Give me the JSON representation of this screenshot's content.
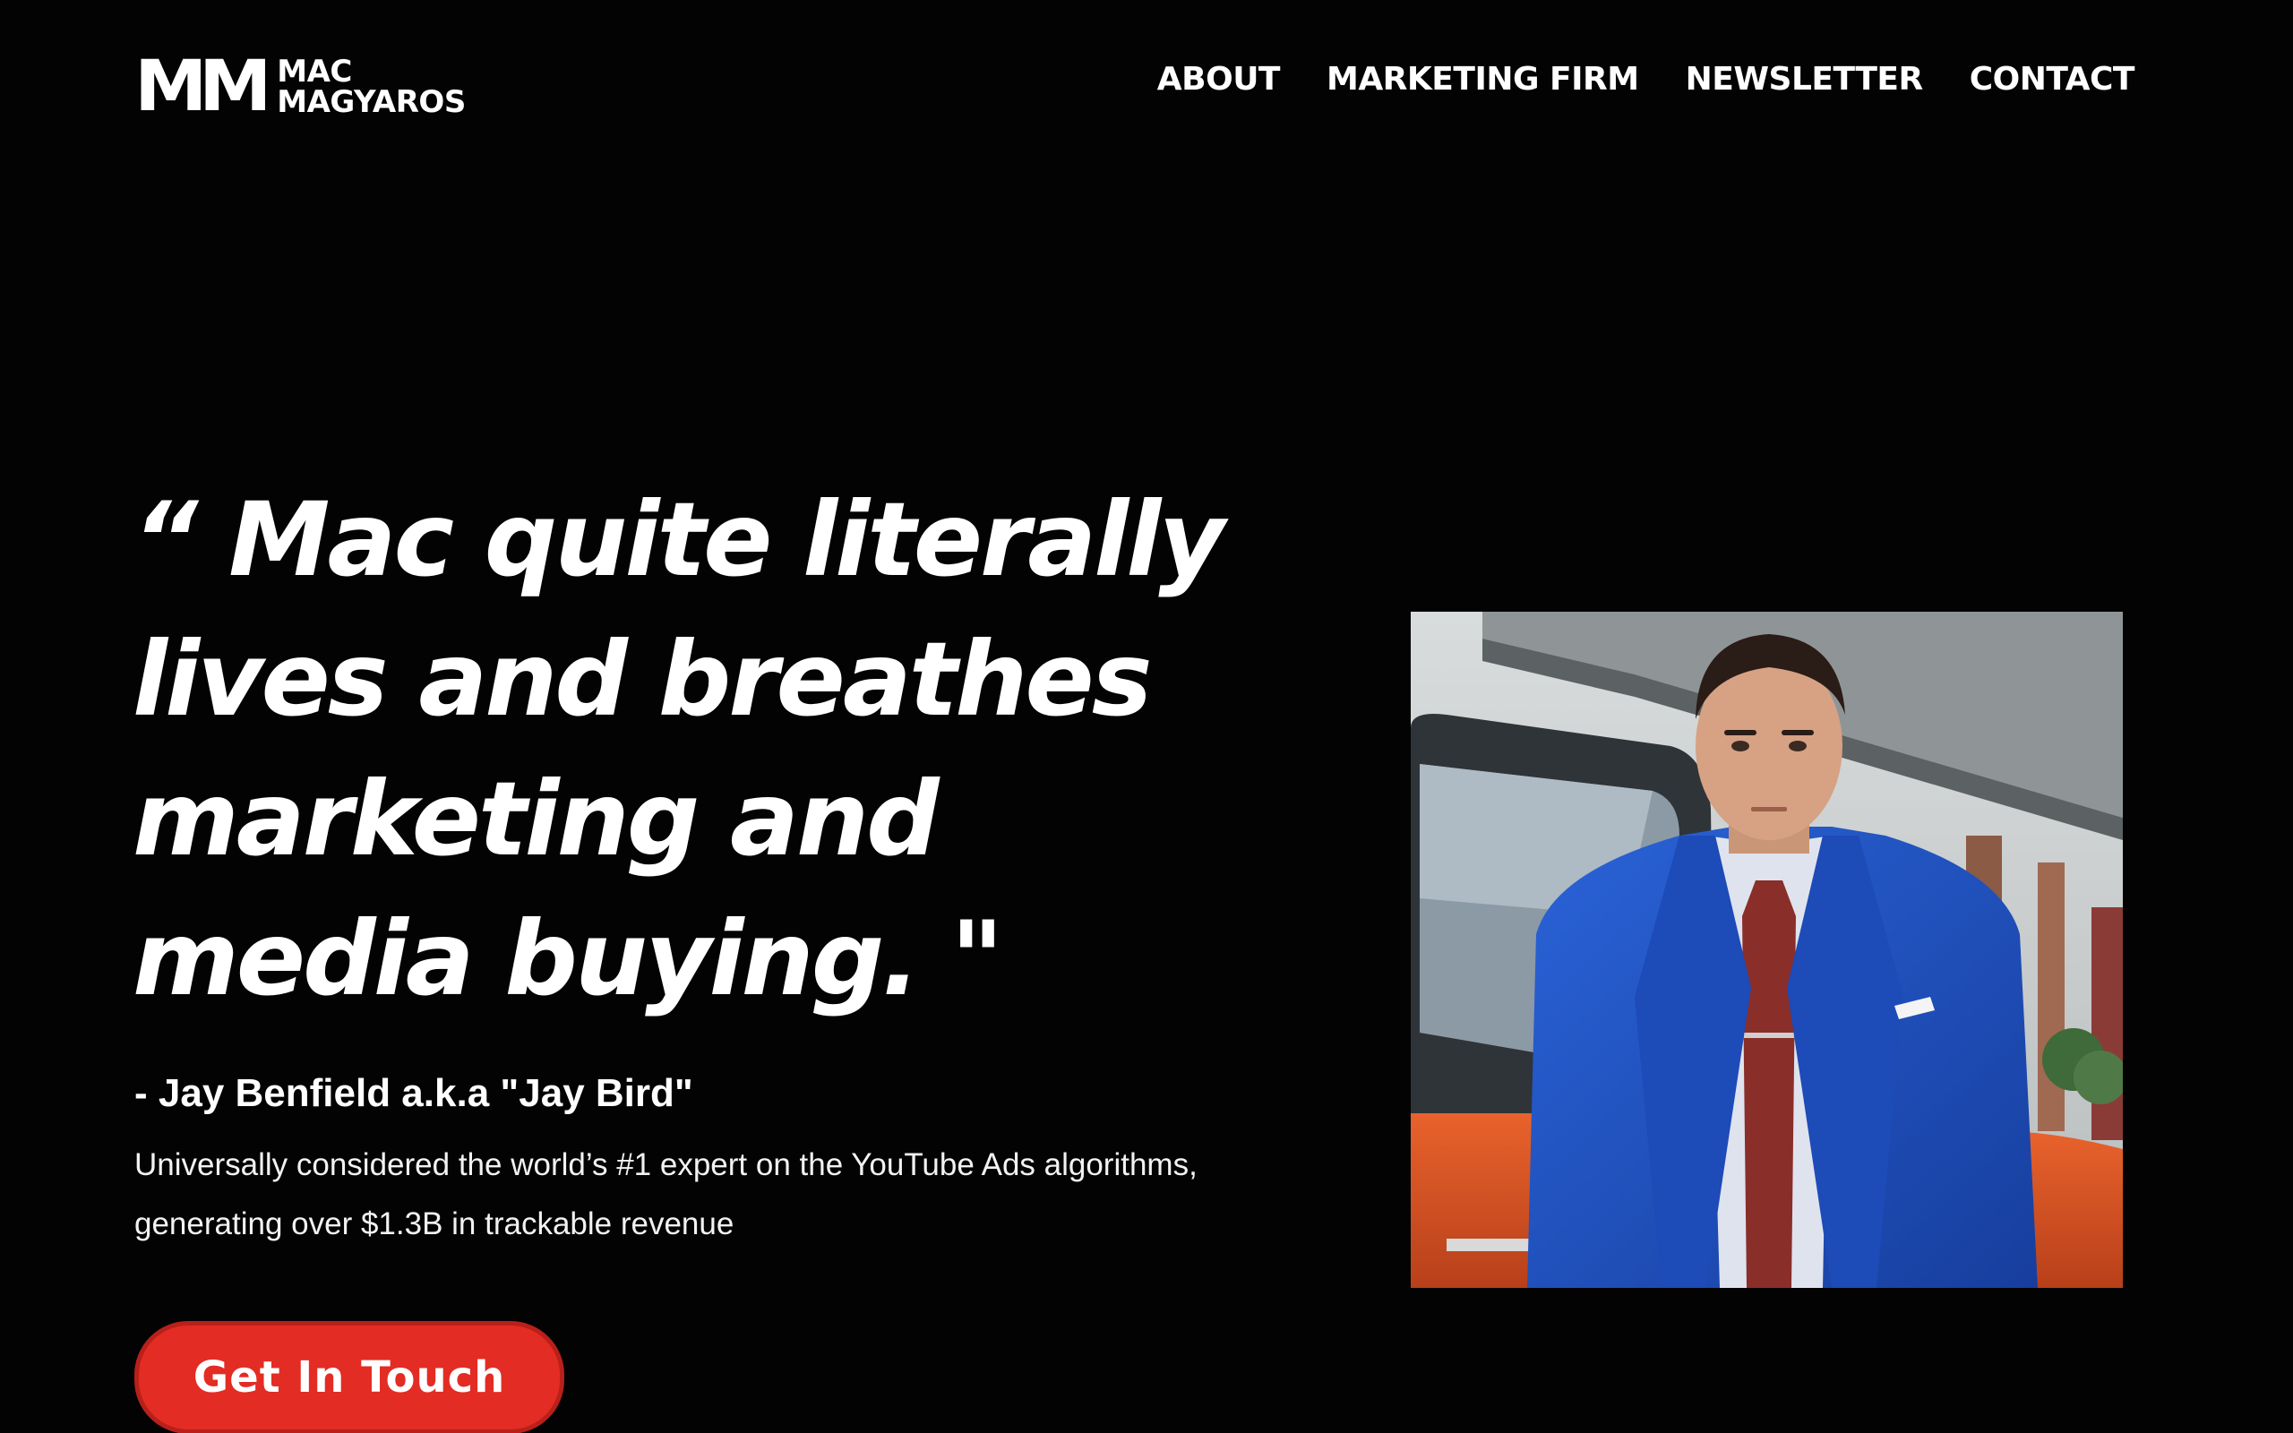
{
  "brand": {
    "mark": "MM",
    "line1": "MAC",
    "line2": "MAGYAROS"
  },
  "nav": {
    "items": [
      {
        "label": "ABOUT"
      },
      {
        "label": "MARKETING FIRM"
      },
      {
        "label": "NEWSLETTER"
      },
      {
        "label": "CONTACT"
      }
    ]
  },
  "hero": {
    "quote": "“ Mac quite literally lives and breathes marketing and media buying. \"",
    "author": "- Jay Benfield a.k.a \"Jay Bird\"",
    "description": "Universally considered the world’s #1 expert on the YouTube Ads algorithms, generating over $1.3B in trackable revenue",
    "cta_label": "Get In Touch"
  },
  "colors": {
    "background": "#030303",
    "text": "#ffffff",
    "cta": "#e32c24",
    "suit": "#1f4fbf"
  }
}
